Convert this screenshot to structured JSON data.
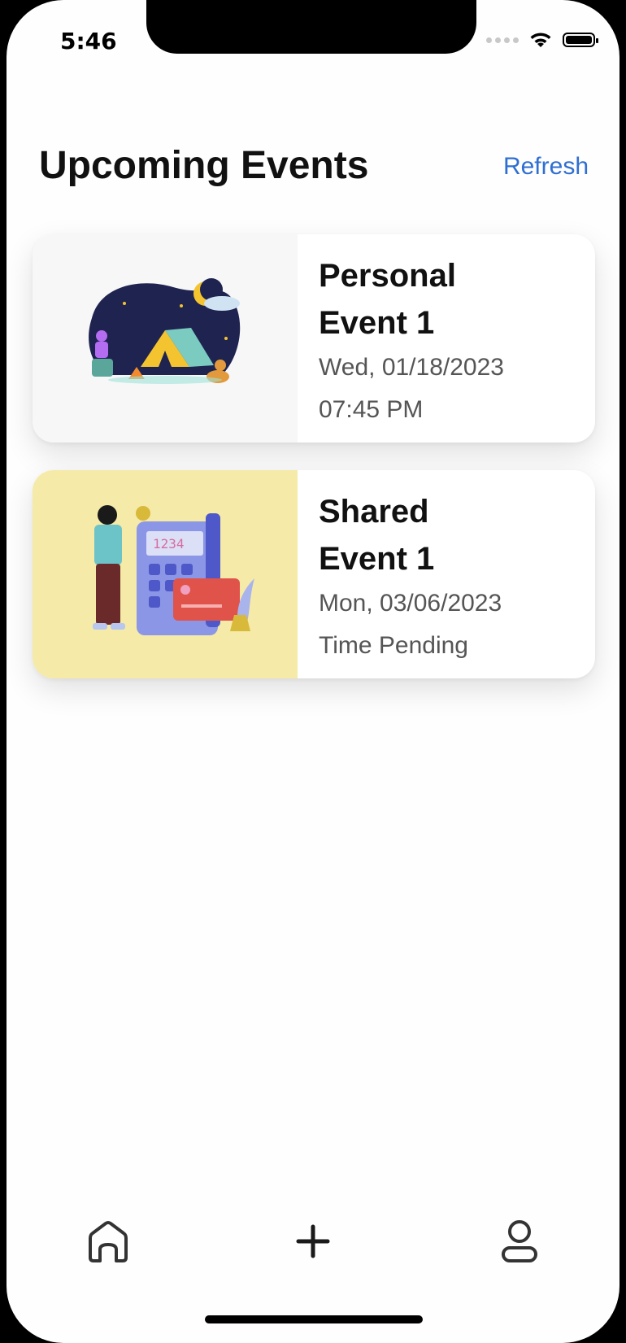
{
  "status_bar": {
    "time": "5:46"
  },
  "header": {
    "title": "Upcoming Events",
    "refresh_label": "Refresh"
  },
  "events": [
    {
      "title": "Personal Event 1",
      "date": "Wed, 01/18/2023",
      "time": "07:45 PM",
      "image": "camping-illustration"
    },
    {
      "title": "Shared Event 1",
      "date": "Mon, 03/06/2023",
      "time": "Time Pending",
      "image": "payment-illustration"
    }
  ],
  "tabbar": {
    "items": [
      "home-icon",
      "plus-icon",
      "profile-icon"
    ]
  },
  "colors": {
    "accent": "#2f6fd1",
    "shared_card_bg": "#f5eaa8"
  }
}
